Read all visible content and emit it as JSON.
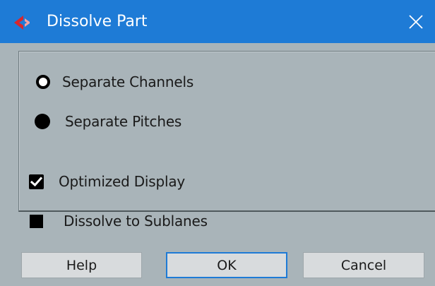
{
  "window": {
    "title": "Dissolve Part",
    "app_icon": "cubase-icon",
    "close_icon": "close-icon"
  },
  "options": {
    "separate_channels": {
      "label": "Separate Channels",
      "selected": false
    },
    "separate_pitches": {
      "label": "Separate Pitches",
      "selected": true
    },
    "optimized_display": {
      "label": "Optimized Display",
      "checked": true
    },
    "dissolve_to_sublanes": {
      "label": "Dissolve to Sublanes",
      "checked": false
    }
  },
  "buttons": {
    "help": "Help",
    "ok": "OK",
    "cancel": "Cancel"
  },
  "colors": {
    "titlebar": "#1e7bd6",
    "background": "#a9b4b9",
    "icon_red": "#d8262c"
  }
}
